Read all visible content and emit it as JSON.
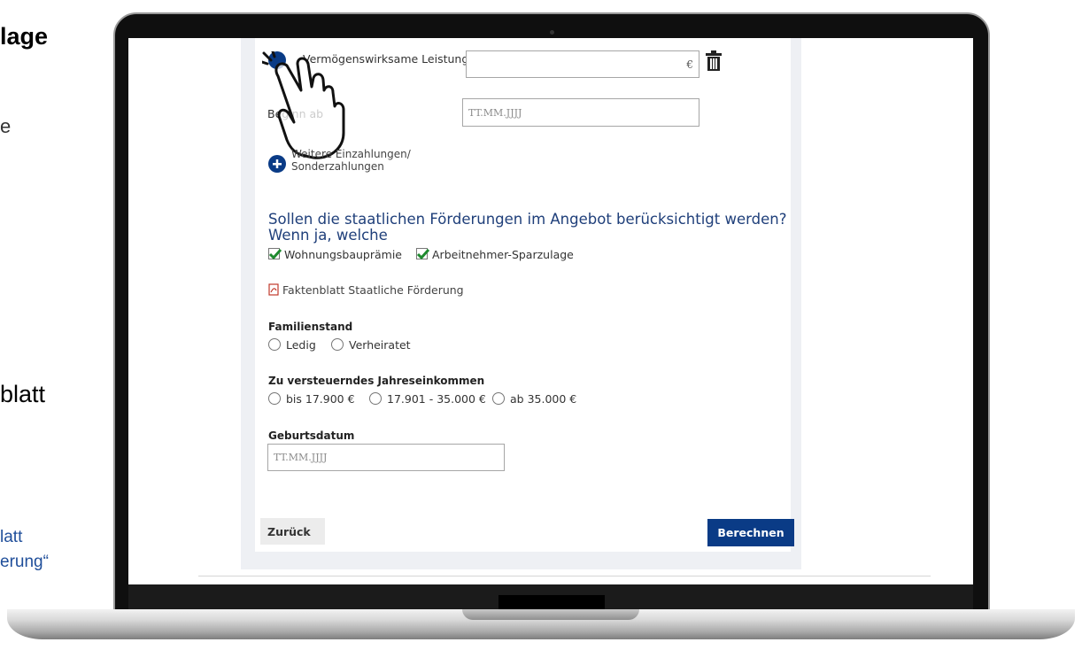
{
  "slide": {
    "title_fragment": "lage",
    "dot_fragment": "e",
    "blatt_fragment": "blatt",
    "link_line1": "latt",
    "link_line2": "erung“"
  },
  "form": {
    "vl_label": "Vermögenswirksame Leistung",
    "vl_currency": "€",
    "begin_label": "Beginn ab",
    "begin_placeholder": "TT.MM.JJJJ",
    "more_payments_line1": "Weitere Einzahlungen/",
    "more_payments_line2": "Sonderzahlungen",
    "question": "Sollen die staatlichen Förderungen im Angebot berücksichtigt werden? Wenn ja, welche",
    "option_wohnungsbau": "Wohnungsbauprämie",
    "option_arbeitnehmer": "Arbeitnehmer-Sparzulage",
    "factsheet_link": "Faktenblatt Staatliche Förderung",
    "family_status_label": "Familienstand",
    "family_options": [
      "Ledig",
      "Verheiratet"
    ],
    "income_label": "Zu versteuerndes Jahreseinkommen",
    "income_options": [
      "bis 17.900 €",
      "17.901 - 35.000 €",
      "ab 35.000 €"
    ],
    "birthdate_label": "Geburtsdatum",
    "birthdate_placeholder": "TT.MM.JJJJ",
    "back_button": "Zurück",
    "calculate_button": "Berechnen"
  },
  "colors": {
    "primary_blue": "#0a3b86",
    "check_green": "#1e8a2e",
    "question_blue": "#1f3f7a"
  },
  "icons": [
    "trash-icon",
    "plus-circle-icon",
    "pdf-icon",
    "hand-pointer-icon",
    "check-icon"
  ]
}
